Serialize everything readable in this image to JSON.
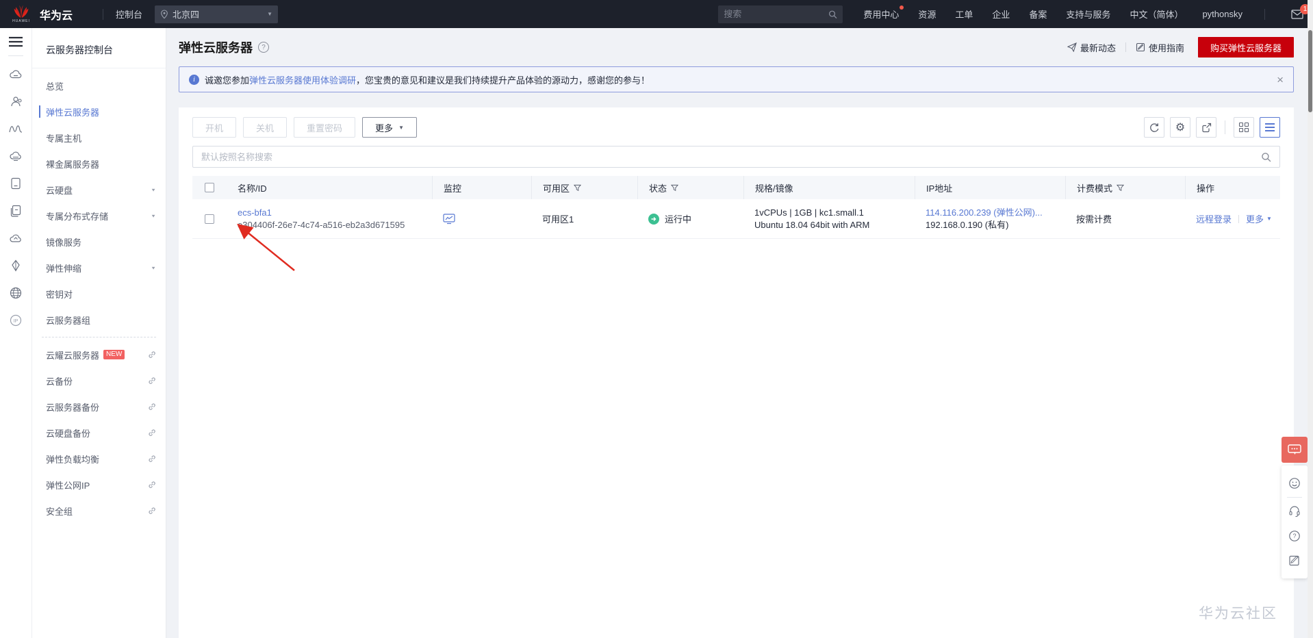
{
  "topbar": {
    "brand": "华为云",
    "console": "控制台",
    "region": "北京四",
    "search_placeholder": "搜索",
    "nav": [
      "费用中心",
      "资源",
      "工单",
      "企业",
      "备案",
      "支持与服务",
      "中文（简体）",
      "pythonsky"
    ],
    "mail_badge": "1"
  },
  "sidebar": {
    "title": "云服务器控制台",
    "items": [
      {
        "label": "总览"
      },
      {
        "label": "弹性云服务器",
        "active": true
      },
      {
        "label": "专属主机"
      },
      {
        "label": "裸金属服务器"
      },
      {
        "label": "云硬盘",
        "caret": true
      },
      {
        "label": "专属分布式存储",
        "caret": true
      },
      {
        "label": "镜像服务"
      },
      {
        "label": "弹性伸缩",
        "caret": true
      },
      {
        "label": "密钥对"
      },
      {
        "label": "云服务器组"
      },
      {
        "divider": true
      },
      {
        "label": "云耀云服务器",
        "badge": "NEW",
        "link": true
      },
      {
        "label": "云备份",
        "link": true
      },
      {
        "label": "云服务器备份",
        "link": true
      },
      {
        "label": "云硬盘备份",
        "link": true
      },
      {
        "label": "弹性负载均衡",
        "link": true
      },
      {
        "label": "弹性公网IP",
        "link": true
      },
      {
        "label": "安全组",
        "link": true
      }
    ]
  },
  "page": {
    "title": "弹性云服务器",
    "link_news": "最新动态",
    "link_guide": "使用指南",
    "buy_button": "购买弹性云服务器"
  },
  "banner": {
    "prefix": "诚邀您参加",
    "link": "弹性云服务器使用体验调研",
    "suffix": "，您宝贵的意见和建议是我们持续提升产品体验的源动力，感谢您的参与！"
  },
  "toolbar": {
    "start": "开机",
    "stop": "关机",
    "reset": "重置密码",
    "more": "更多"
  },
  "filter": {
    "placeholder": "默认按照名称搜索"
  },
  "table": {
    "columns": [
      "名称/ID",
      "监控",
      "可用区",
      "状态",
      "规格/镜像",
      "IP地址",
      "计费模式",
      "操作"
    ],
    "row": {
      "name": "ecs-bfa1",
      "id": "e304406f-26e7-4c74-a516-eb2a3d671595",
      "az": "可用区1",
      "status": "运行中",
      "spec": "1vCPUs | 1GB | kc1.small.1",
      "image": "Ubuntu 18.04 64bit with ARM",
      "ip_public": "114.116.200.239 (弹性公网)...",
      "ip_private": "192.168.0.190 (私有)",
      "billing": "按需计费",
      "op_remote": "远程登录",
      "op_more": "更多"
    }
  },
  "glyphs": {
    "caret_down": "▼",
    "close": "×",
    "gear": "⚙"
  },
  "colors": {
    "accent": "#5878d2",
    "brand_red": "#c7000b",
    "status_green": "#3cc092",
    "new_badge": "#f26161"
  },
  "watermark": "华为云社区"
}
